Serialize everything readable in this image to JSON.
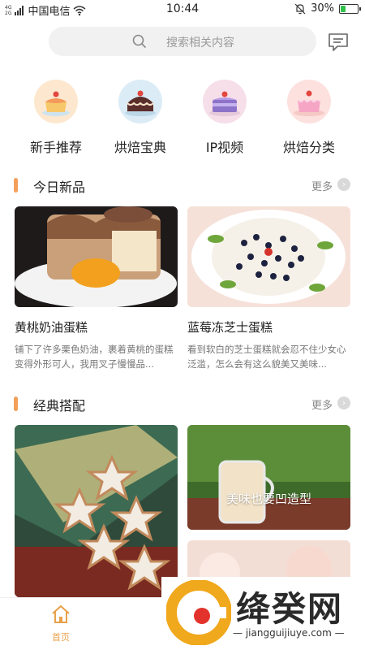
{
  "status_bar": {
    "signal_top": "4G",
    "signal_bottom": "2G",
    "carrier": "中国电信",
    "time": "10:44",
    "battery_percent": "30%",
    "battery_level": 0.3,
    "battery_color": "#2fc14a"
  },
  "search": {
    "placeholder": "搜索相关内容",
    "icon": "search-icon"
  },
  "header": {
    "message_icon": "message-icon"
  },
  "categories": [
    {
      "label": "新手推荐",
      "icon": "cake-beginner-icon",
      "color": "#fde8cf"
    },
    {
      "label": "烘焙宝典",
      "icon": "cake-chocolate-icon",
      "color": "#dcecf6"
    },
    {
      "label": "IP视频",
      "icon": "cake-purple-icon",
      "color": "#f6dfe9"
    },
    {
      "label": "烘焙分类",
      "icon": "cake-pink-icon",
      "color": "#fde1df"
    }
  ],
  "today_new": {
    "title": "今日新品",
    "more": "更多",
    "items": [
      {
        "title": "黄桃奶油蛋糕",
        "desc": "铺下了许多栗色奶油，裹着黄桃的蛋糕变得外形可人，我用叉子慢慢品..."
      },
      {
        "title": "蓝莓冻芝士蛋糕",
        "desc": "看到软白的芝士蛋糕就会忍不住少女心泛滥，怎么会有这么貌美又美味..."
      }
    ]
  },
  "classic": {
    "title": "经典搭配",
    "more": "更多",
    "featured_caption": "美味也要凹造型"
  },
  "bottom_nav": {
    "home_label": "首页",
    "accent": "#e8a04a"
  },
  "watermark": {
    "brand": "绛癸网",
    "url": "jiangguijiuye.com"
  }
}
